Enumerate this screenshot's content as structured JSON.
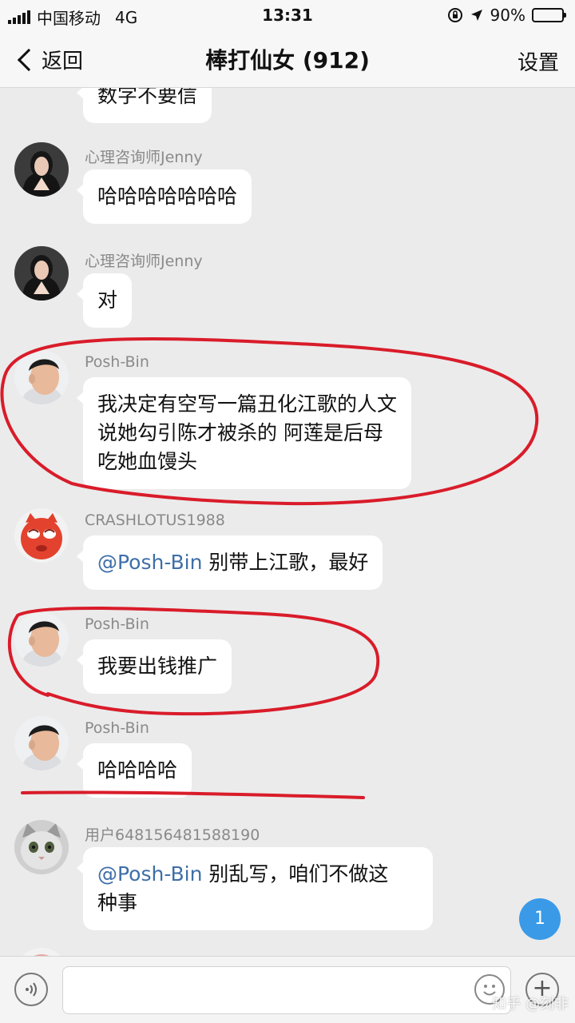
{
  "status_bar": {
    "carrier": "中国移动",
    "network": "4G",
    "time": "13:31",
    "battery_percent": "90%",
    "battery_level": 0.9
  },
  "nav": {
    "back_label": "返回",
    "title": "棒打仙女 (912)",
    "settings_label": "设置"
  },
  "messages": [
    {
      "sender": "",
      "text": "数字不要信"
    },
    {
      "sender": "心理咨询师Jenny",
      "text": "哈哈哈哈哈哈哈"
    },
    {
      "sender": "心理咨询师Jenny",
      "text": "对"
    },
    {
      "sender": "Posh-Bin",
      "lines": [
        "我决定有空写一篇丑化江歌的人文",
        "说她勾引陈才被杀的 阿莲是后母",
        "吃她血馒头"
      ]
    },
    {
      "sender": "CRASHLOTUS1988",
      "mention": "@Posh-Bin",
      "text": " 别带上江歌，最好"
    },
    {
      "sender": "Posh-Bin",
      "text": "我要出钱推广"
    },
    {
      "sender": "Posh-Bin",
      "text": "哈哈哈哈"
    },
    {
      "sender": "用户648156481588190",
      "mention": "@Posh-Bin",
      "text": " 别乱写，咱们不做这",
      "text2": "种事"
    }
  ],
  "unread_badge": "1",
  "watermark": "知乎 @刻非",
  "colors": {
    "background": "#ebebeb",
    "bubble": "#ffffff",
    "mention": "#3e6ea8",
    "annotation_red": "#d91c2a",
    "badge": "#3a9ae8"
  }
}
